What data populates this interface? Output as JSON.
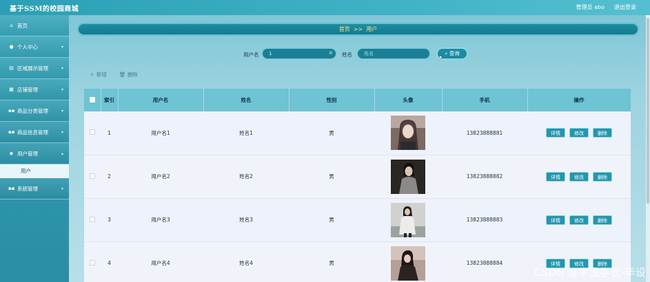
{
  "header": {
    "title": "基于SSM的校园商城",
    "admin_text": "管理员 abo",
    "logout": "退出登录"
  },
  "sidebar": {
    "items": [
      {
        "label": "首页",
        "icon": "home-icon"
      },
      {
        "label": "个人中心",
        "icon": "user-icon"
      },
      {
        "label": "区域展示管理",
        "icon": "list-icon"
      },
      {
        "label": "店铺管理",
        "icon": "store-icon"
      },
      {
        "label": "商品分类管理",
        "icon": "grid-icon"
      },
      {
        "label": "商品信息管理",
        "icon": "grid-icon"
      },
      {
        "label": "用户管理",
        "icon": "user-group-icon"
      },
      {
        "label": "系统管理",
        "icon": "grid-icon"
      }
    ],
    "submenu_label": "用户"
  },
  "breadcrumb": {
    "home": "首页",
    "separator": ">>",
    "current": "用户"
  },
  "search": {
    "username_label": "用户名",
    "username_value": "1",
    "name_label": "姓名",
    "name_placeholder": "姓名",
    "query_button": "查询"
  },
  "actions": {
    "add": "新增",
    "delete": "删除"
  },
  "table": {
    "headers": [
      "索引",
      "用户名",
      "姓名",
      "性别",
      "头像",
      "手机",
      "操作"
    ],
    "rows": [
      {
        "index": "1",
        "username": "用户名1",
        "name": "姓名1",
        "gender": "男",
        "phone": "13823888881"
      },
      {
        "index": "2",
        "username": "用户名2",
        "name": "姓名2",
        "gender": "男",
        "phone": "13823888882"
      },
      {
        "index": "3",
        "username": "用户名3",
        "name": "姓名3",
        "gender": "男",
        "phone": "13823888883"
      },
      {
        "index": "4",
        "username": "用户名4",
        "name": "姓名4",
        "gender": "男",
        "phone": "13823888884"
      }
    ],
    "ops": {
      "detail": "详情",
      "edit": "修改",
      "delete": "删除"
    }
  },
  "watermark": "CSDN @宇澄学长-毕设",
  "colors": {
    "accent": "#1c8aa0",
    "sidebar": "#2f97ad",
    "header_row": "#6ec3d4",
    "breadcrumb_text": "#ffe680"
  }
}
